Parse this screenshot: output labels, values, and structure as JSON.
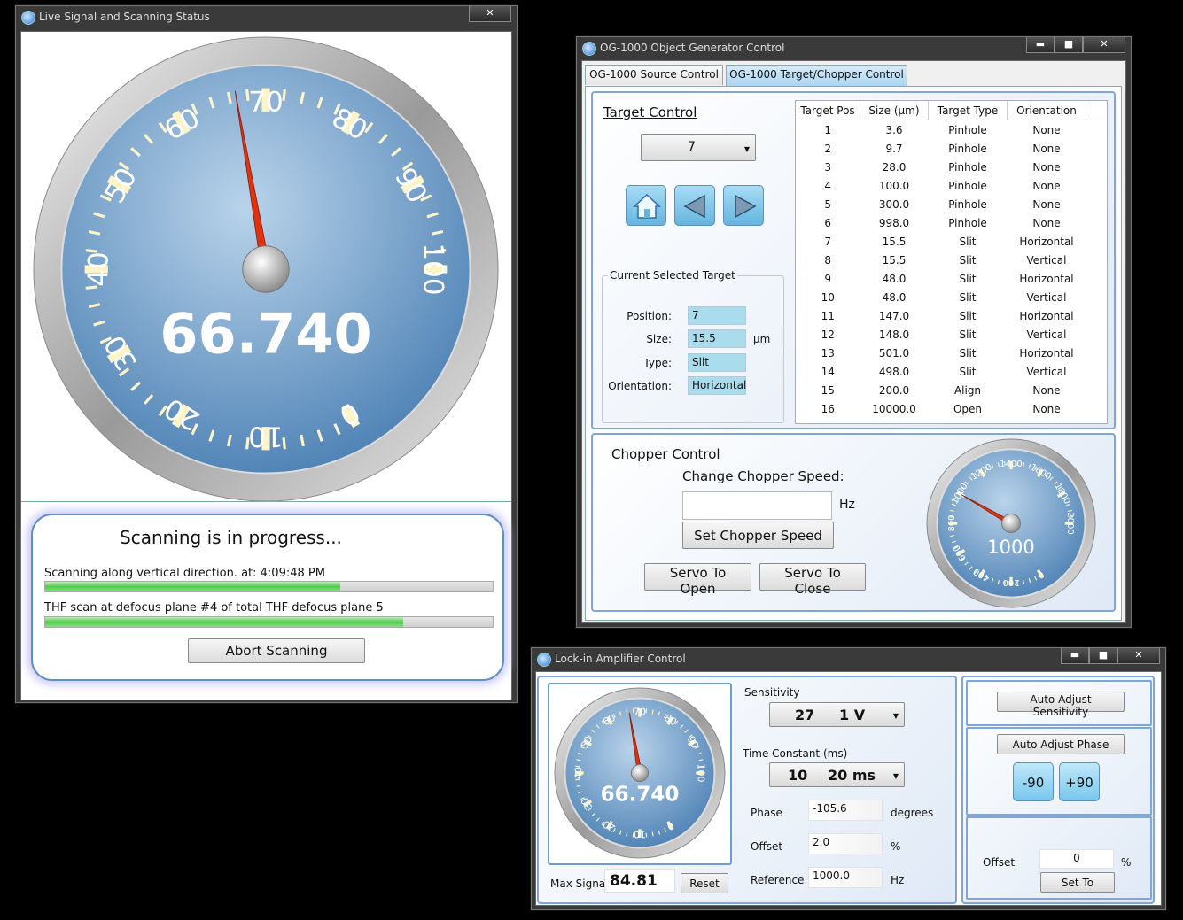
{
  "colors": {
    "dial_blue": "#4a7fb3",
    "needle": "#e0320f",
    "tick": "#fdf4c8",
    "progress_green": "#52c94d"
  },
  "live_window": {
    "title": "Live Signal and Scanning Status",
    "close": "✕",
    "gauge": {
      "value_text": "66.740",
      "needle_value": 66.74,
      "min": 0,
      "max": 100,
      "tick_labels": [
        "0",
        "10",
        "20",
        "30",
        "40",
        "50",
        "60",
        "70",
        "80",
        "90",
        "100"
      ]
    },
    "status_title": "Scanning is in progress...",
    "scan1_text": "Scanning along vertical direction. at: 4:09:48 PM",
    "scan1_progress": 0.66,
    "scan2_text": "THF scan at defocus plane #4 of total THF defocus plane 5",
    "scan2_progress": 0.8,
    "abort_label": "Abort Scanning"
  },
  "og_window": {
    "title": "OG-1000 Object Generator Control",
    "minimize": "▬",
    "maximize": "■",
    "close": "✕",
    "tabs": [
      {
        "label": "OG-1000 Source Control"
      },
      {
        "label": "OG-1000 Target/Chopper Control"
      }
    ],
    "target_control_title": "Target Control",
    "position_select": "7",
    "current_target_title": "Current Selected Target",
    "labels": {
      "position": "Position:",
      "size": "Size:",
      "type": "Type:",
      "orientation": "Orientation:",
      "unit_um": "µm"
    },
    "current": {
      "position": "7",
      "size": "15.5",
      "type": "Slit",
      "orientation": "Horizontal"
    },
    "table_headers": [
      "Target Pos",
      "Size (µm)",
      "Target Type",
      "Orientation"
    ],
    "targets": [
      [
        "1",
        "3.6",
        "Pinhole",
        "None"
      ],
      [
        "2",
        "9.7",
        "Pinhole",
        "None"
      ],
      [
        "3",
        "28.0",
        "Pinhole",
        "None"
      ],
      [
        "4",
        "100.0",
        "Pinhole",
        "None"
      ],
      [
        "5",
        "300.0",
        "Pinhole",
        "None"
      ],
      [
        "6",
        "998.0",
        "Pinhole",
        "None"
      ],
      [
        "7",
        "15.5",
        "Slit",
        "Horizontal"
      ],
      [
        "8",
        "15.5",
        "Slit",
        "Vertical"
      ],
      [
        "9",
        "48.0",
        "Slit",
        "Horizontal"
      ],
      [
        "10",
        "48.0",
        "Slit",
        "Vertical"
      ],
      [
        "11",
        "147.0",
        "Slit",
        "Horizontal"
      ],
      [
        "12",
        "148.0",
        "Slit",
        "Vertical"
      ],
      [
        "13",
        "501.0",
        "Slit",
        "Horizontal"
      ],
      [
        "14",
        "498.0",
        "Slit",
        "Vertical"
      ],
      [
        "15",
        "200.0",
        "Align",
        "None"
      ],
      [
        "16",
        "10000.0",
        "Open",
        "None"
      ]
    ],
    "chopper_title": "Chopper Control",
    "change_speed_label": "Change Chopper Speed:",
    "speed_value": "",
    "hz": "Hz",
    "set_speed_label": "Set Chopper Speed",
    "servo_open_label": "Servo To Open",
    "servo_close_label": "Servo To Close",
    "chopper_gauge": {
      "value_text": "1000",
      "needle_value": 1000,
      "min": 0,
      "max": 2000,
      "tick_labels": [
        "0",
        "200",
        "400",
        "600",
        "800",
        "1000",
        "1200",
        "1400",
        "1600",
        "1800",
        "2000"
      ]
    }
  },
  "lockin_window": {
    "title": "Lock-in Amplifier Control",
    "minimize": "▬",
    "maximize": "■",
    "close": "✕",
    "gauge": {
      "value_text": "66.740",
      "needle_value": 66.74,
      "min": 0,
      "max": 100,
      "tick_labels": [
        "0",
        "10",
        "20",
        "30",
        "40",
        "50",
        "60",
        "70",
        "80",
        "90",
        "100"
      ]
    },
    "max_signal_label": "Max Signal",
    "max_signal_value": "84.81",
    "reset_label": "Reset",
    "sensitivity_label": "Sensitivity",
    "sensitivity_index": "27",
    "sensitivity_value": "1 V",
    "time_constant_label": "Time Constant (ms)",
    "time_constant_index": "10",
    "time_constant_value": "20 ms",
    "phase_label": "Phase",
    "phase_value": "-105.6",
    "phase_unit": "degrees",
    "offset_label": "Offset",
    "offset_value": "2.0",
    "offset_unit": "%",
    "reference_label": "Reference",
    "reference_value": "1000.0",
    "reference_unit": "Hz",
    "auto_sensitivity_label": "Auto Adjust Sensitivity",
    "auto_phase_label": "Auto Adjust Phase",
    "minus90_label": "-90",
    "plus90_label": "+90",
    "right_offset_label": "Offset",
    "right_offset_value": "0",
    "right_offset_unit": "%",
    "set_to_label": "Set To"
  }
}
